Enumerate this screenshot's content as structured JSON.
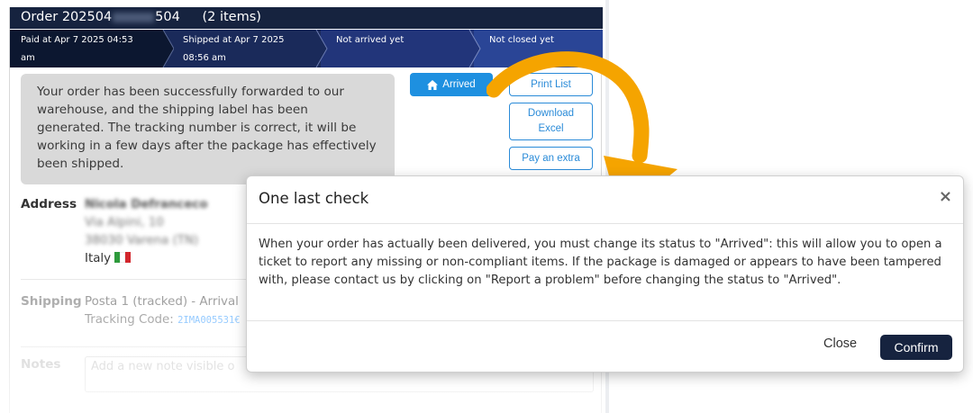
{
  "order": {
    "title_prefix": "Order 202504",
    "title_suffix": "504",
    "items_count": "(2 items)"
  },
  "steps": [
    {
      "label_line1": "Paid at Apr 7 2025 04:53",
      "label_line2": "am"
    },
    {
      "label_line1": "Shipped at Apr 7 2025",
      "label_line2": "08:56 am"
    },
    {
      "label_line1": "Not arrived yet",
      "label_line2": ""
    },
    {
      "label_line1": "Not closed yet",
      "label_line2": ""
    }
  ],
  "notice": "Your order has been successfully forwarded to our warehouse, and the shipping label has been generated. The tracking number is correct, it will be working in a few days after the package has effectively been shipped.",
  "actions": {
    "arrived": "Arrived",
    "arrived_icon": "home-icon",
    "print_list": "Print List",
    "download_excel_line1": "Download",
    "download_excel_line2": "Excel",
    "pay_extra": "Pay an extra"
  },
  "address": {
    "label": "Address",
    "name": "Nicola Defranceco",
    "street": "Via Alpini, 10",
    "city": "38030 Varena (TN)",
    "country": "Italy"
  },
  "shipping": {
    "label": "Shipping",
    "method": "Posta 1 (tracked) - Arrival",
    "tracking_label": "Tracking Code:",
    "tracking_code": "2IMA005531€"
  },
  "notes": {
    "label": "Notes",
    "placeholder": "Add a new note visible o"
  },
  "modal": {
    "title": "One last check",
    "close_icon": "×",
    "body": "When your order has actually been delivered, you must change its status to \"Arrived\": this will allow you to open a ticket to report any missing or non-compliant items. If the package is damaged or appears to have been tampered with, please contact us by clicking on \"Report a problem\" before changing the status to \"Arrived\".",
    "close_label": "Close",
    "confirm_label": "Confirm"
  },
  "colors": {
    "header": "#16233f",
    "primary": "#1e90e0",
    "confirm": "#16233f",
    "arrow": "#f5a400",
    "flag_green": "#2e9a3c",
    "flag_white": "#ffffff",
    "flag_red": "#d2262c"
  }
}
